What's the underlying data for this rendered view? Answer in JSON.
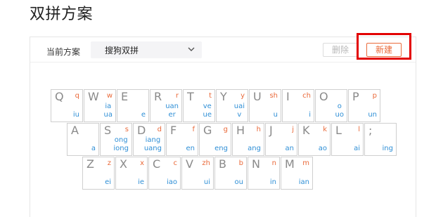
{
  "page": {
    "title": "双拼方案"
  },
  "toolbar": {
    "scheme_label": "当前方案",
    "scheme_value": "搜狗双拼",
    "delete_label": "删除",
    "new_label": "新建"
  },
  "colors": {
    "initial": "#ea6a3a",
    "final": "#2f8fd6",
    "highlight": "#e30000"
  },
  "keyboard": {
    "row1": [
      {
        "letter": "Q",
        "initial": "q",
        "finals": [
          "iu"
        ]
      },
      {
        "letter": "W",
        "initial": "w",
        "finals": [
          "ia",
          "ua"
        ]
      },
      {
        "letter": "E",
        "initial": "",
        "finals": [
          "e"
        ]
      },
      {
        "letter": "R",
        "initial": "r",
        "finals": [
          "uan",
          "er"
        ]
      },
      {
        "letter": "T",
        "initial": "t",
        "finals": [
          "ve",
          "ue"
        ]
      },
      {
        "letter": "Y",
        "initial": "y",
        "finals": [
          "uai",
          "v"
        ]
      },
      {
        "letter": "U",
        "initial": "sh",
        "finals": [
          "u"
        ]
      },
      {
        "letter": "I",
        "initial": "ch",
        "finals": [
          "i"
        ]
      },
      {
        "letter": "O",
        "initial": "",
        "finals": [
          "o",
          "uo"
        ]
      },
      {
        "letter": "P",
        "initial": "p",
        "finals": [
          "un"
        ]
      }
    ],
    "row2": [
      {
        "letter": "A",
        "initial": "",
        "finals": [
          "a"
        ]
      },
      {
        "letter": "S",
        "initial": "s",
        "finals": [
          "ong",
          "iong"
        ]
      },
      {
        "letter": "D",
        "initial": "d",
        "finals": [
          "iang",
          "uang"
        ]
      },
      {
        "letter": "F",
        "initial": "f",
        "finals": [
          "en"
        ]
      },
      {
        "letter": "G",
        "initial": "g",
        "finals": [
          "eng"
        ]
      },
      {
        "letter": "H",
        "initial": "h",
        "finals": [
          "ang"
        ]
      },
      {
        "letter": "J",
        "initial": "j",
        "finals": [
          "an"
        ]
      },
      {
        "letter": "K",
        "initial": "k",
        "finals": [
          "ao"
        ]
      },
      {
        "letter": "L",
        "initial": "l",
        "finals": [
          "ai"
        ]
      },
      {
        "letter": ";",
        "initial": "",
        "finals": [
          "ing"
        ]
      }
    ],
    "row3": [
      {
        "letter": "Z",
        "initial": "z",
        "finals": [
          "ei"
        ]
      },
      {
        "letter": "X",
        "initial": "x",
        "finals": [
          "ie"
        ]
      },
      {
        "letter": "C",
        "initial": "c",
        "finals": [
          "iao"
        ]
      },
      {
        "letter": "V",
        "initial": "zh",
        "finals": [
          "ui"
        ]
      },
      {
        "letter": "B",
        "initial": "b",
        "finals": [
          "ou"
        ]
      },
      {
        "letter": "N",
        "initial": "n",
        "finals": [
          "in"
        ]
      },
      {
        "letter": "M",
        "initial": "m",
        "finals": [
          "ian"
        ]
      }
    ]
  }
}
